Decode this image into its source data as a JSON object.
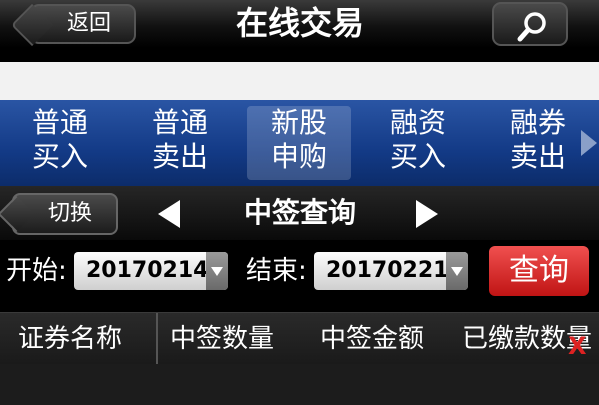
{
  "navbar": {
    "back_label": "返回",
    "title": "在线交易",
    "search_icon": "search-icon"
  },
  "menu": {
    "items": [
      {
        "line1": "普通",
        "line2": "买入"
      },
      {
        "line1": "普通",
        "line2": "卖出"
      },
      {
        "line1": "新股",
        "line2": "申购",
        "active": true
      },
      {
        "line1": "融资",
        "line2": "买入"
      },
      {
        "line1": "融券",
        "line2": "卖出"
      }
    ],
    "more_icon": "chevron-right-icon"
  },
  "switch_bar": {
    "switch_label": "切换",
    "title": "中签查询"
  },
  "filter": {
    "start_label": "开始:",
    "start_value": "20170214",
    "end_label": "结束:",
    "end_value": "20170221",
    "query_label": "查询"
  },
  "table": {
    "headers": [
      "证券名称",
      "中签数量",
      "中签金额",
      "已缴款数量"
    ],
    "marker": "X"
  },
  "colors": {
    "menu_blue": "#1a468f",
    "query_red": "#d62d2d"
  }
}
